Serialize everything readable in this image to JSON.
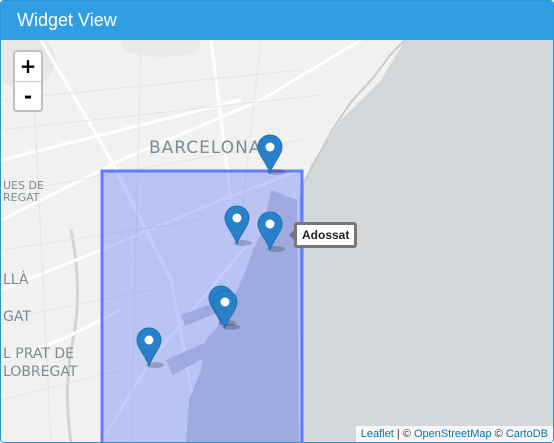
{
  "widget": {
    "title": "Widget View"
  },
  "zoom": {
    "in_label": "+",
    "out_label": "-"
  },
  "map_labels": [
    {
      "id": "barcelona",
      "text": "BARCELONA"
    },
    {
      "id": "ues-de",
      "text": "UES DE"
    },
    {
      "id": "regat",
      "text": "REGAT"
    },
    {
      "id": "lla",
      "text": "LLÀ"
    },
    {
      "id": "gat",
      "text": "GAT"
    },
    {
      "id": "prat",
      "text": "L PRAT DE"
    },
    {
      "id": "llobregat",
      "text": "LOBREGAT"
    }
  ],
  "markers": [
    {
      "id": "marker-1",
      "color": "#2a81cb"
    },
    {
      "id": "marker-2",
      "color": "#2a81cb"
    },
    {
      "id": "marker-3",
      "color": "#2a81cb"
    },
    {
      "id": "marker-4",
      "color": "#2a81cb"
    },
    {
      "id": "marker-5",
      "color": "#2a81cb"
    },
    {
      "id": "marker-6",
      "color": "#2a81cb"
    }
  ],
  "tooltip": {
    "text": "Adossat"
  },
  "rectangle": {
    "fill": "#3f67ff",
    "stroke": "#3f67ff"
  },
  "attribution": {
    "leaflet": "Leaflet",
    "separator1": " | © ",
    "osm": "OpenStreetMap",
    "separator2": " © ",
    "carto": "CartoDB"
  },
  "colors": {
    "header": "#2f9ee3",
    "sea": "#d4d8da",
    "land": "#f2f2f0"
  }
}
